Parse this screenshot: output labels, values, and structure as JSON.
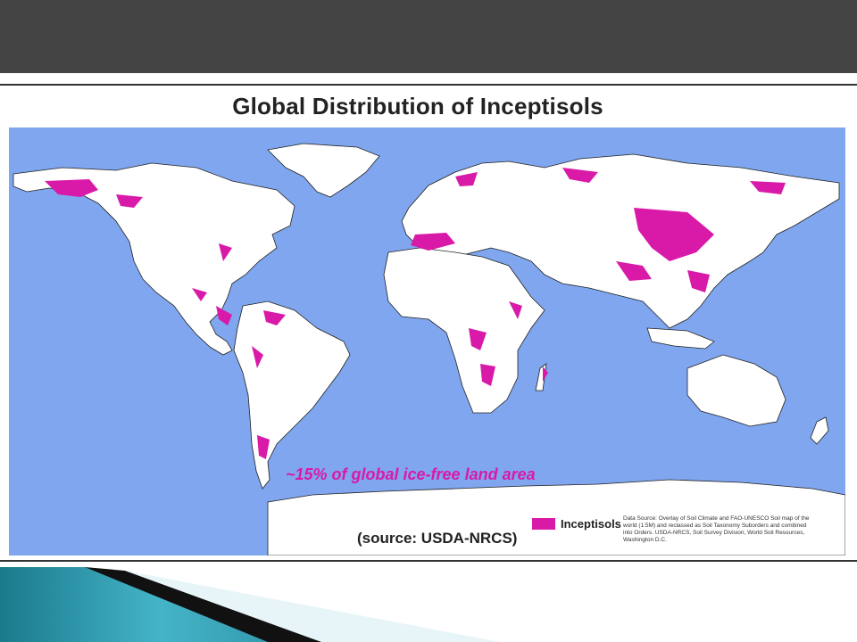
{
  "slide": {
    "header_color": "#444444"
  },
  "map": {
    "title": "Global Distribution of Inceptisols",
    "note": "~15% of global ice-free land area",
    "source": "(source: USDA-NRCS)",
    "legend": {
      "label": "Inceptisols",
      "color": "#d91aa8"
    },
    "data_source": "Data Source: Overlay of Soil Climate and FAO-UNESCO Soil map of the world (1:5M) and reclassed as Soil Taxonomy Suborders and combined into Orders. USDA-NRCS, Soil Survey Division, World Soil Resources, Washington D.C.",
    "colors": {
      "ocean": "#7fa6ee",
      "land": "#ffffff",
      "inceptisols": "#d91aa8"
    }
  }
}
